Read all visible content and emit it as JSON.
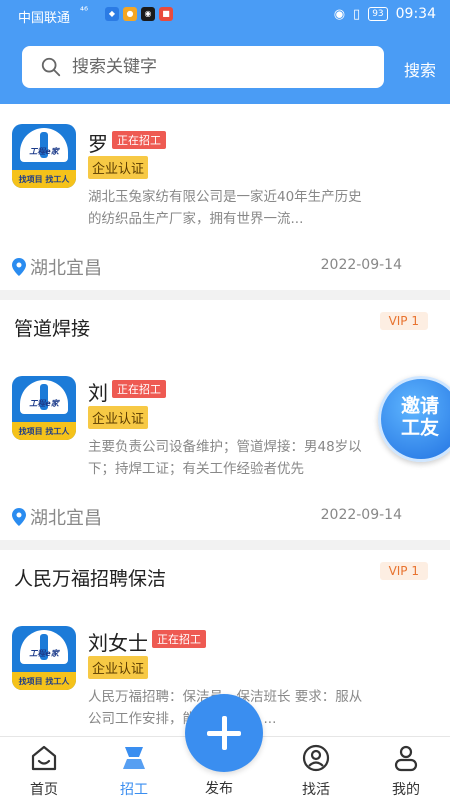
{
  "status_bar": {
    "carrier": "中国联通",
    "signal": "⁴⁶",
    "battery": "93",
    "time": "09:34"
  },
  "search": {
    "placeholder": "搜索关键字",
    "button": "搜索"
  },
  "cards": [
    {
      "job_title": "",
      "vip": "",
      "name": "罗",
      "status": "正在招工",
      "cert": "企业认证",
      "desc": "湖北玉兔家纺有限公司是一家近40年生产历史的纺织品生产厂家，拥有世界一流...",
      "location": "湖北宜昌",
      "date": "2022-09-14"
    },
    {
      "job_title": "管道焊接",
      "vip": "VIP 1",
      "name": "刘",
      "status": "正在招工",
      "cert": "企业认证",
      "desc": "主要负责公司设备维护；管道焊接：男48岁以下；持焊工证；有关工作经验者优先",
      "location": "湖北宜昌",
      "date": "2022-09-14"
    },
    {
      "job_title": "人民万福招聘保洁",
      "vip": "VIP 1",
      "name": "刘女士",
      "status": "正在招工",
      "cert": "企业认证",
      "desc": "人民万福招聘：保洁员、保洁班长 要求：服从公司工作安排，能吃苦耐劳，...",
      "location": "",
      "date": ""
    }
  ],
  "logo": {
    "line1": "工程e家",
    "line2": "找项目 找工人"
  },
  "invite": {
    "label": "邀请工友"
  },
  "nav": {
    "home": "首页",
    "recruit": "招工",
    "publish": "发布",
    "find_work": "找活",
    "mine": "我的"
  }
}
